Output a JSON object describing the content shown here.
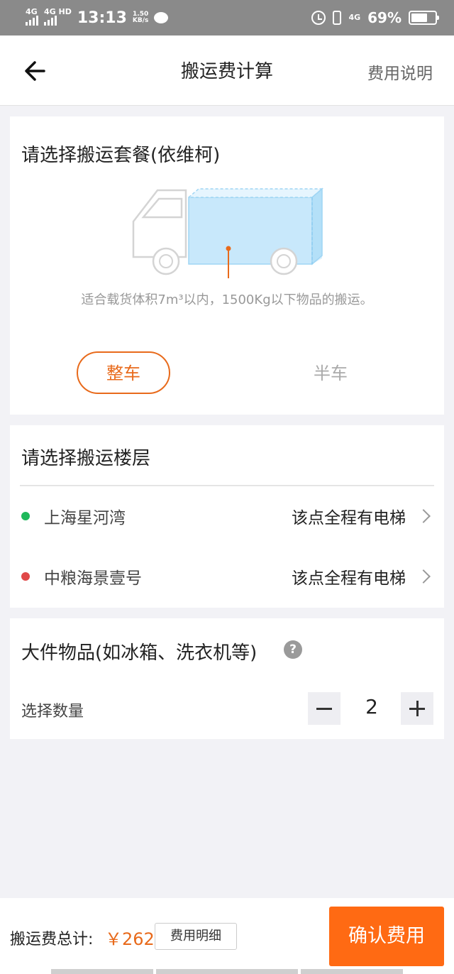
{
  "status_bar": {
    "sim1": "4G",
    "sim2": "4G HD",
    "time": "13:13",
    "speed_value": "1.50",
    "speed_unit": "KB/s",
    "network": "4G",
    "battery": "69%"
  },
  "nav": {
    "title": "搬运费计算",
    "right_label": "费用说明"
  },
  "package": {
    "title": "请选择搬运套餐(依维柯)",
    "description": "适合载货体积7m³以内，1500Kg以下物品的搬运。",
    "options": [
      {
        "label": "整车",
        "selected": true
      },
      {
        "label": "半车",
        "selected": false
      }
    ],
    "accent_color": "#e86a1b",
    "truck_cargo_color": "#c8e8fb"
  },
  "floors": {
    "title": "请选择搬运楼层",
    "rows": [
      {
        "name": "上海星河湾",
        "status": "该点全程有电梯",
        "dot_color": "#1eb85a"
      },
      {
        "name": "中粮海景壹号",
        "status": "该点全程有电梯",
        "dot_color": "#e04848"
      }
    ]
  },
  "large_items": {
    "title": "大件物品(如冰箱、洗衣机等)",
    "help_icon": "?",
    "qty_label": "选择数量",
    "quantity": "2"
  },
  "footer": {
    "total_label": "搬运费总计:",
    "total_value": "￥262",
    "detail_label": "费用明细",
    "confirm_label": "确认费用",
    "confirm_color": "#ff6a13"
  }
}
